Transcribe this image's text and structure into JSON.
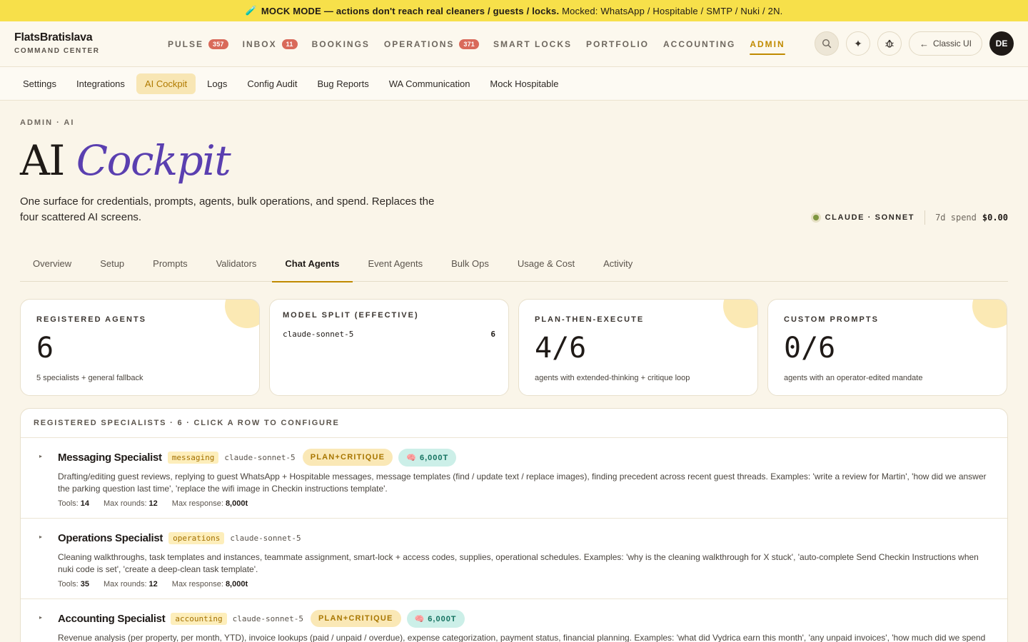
{
  "banner": {
    "icon": "test-tube-icon",
    "strong": "MOCK MODE — actions don't reach real cleaners / guests / locks.",
    "rest": "Mocked: WhatsApp / Hospitable / SMTP / Nuki / 2N."
  },
  "brand": {
    "name": "FlatsBratislava",
    "sub": "COMMAND CENTER"
  },
  "nav": [
    {
      "label": "PULSE",
      "badge": "357"
    },
    {
      "label": "INBOX",
      "badge": "11"
    },
    {
      "label": "BOOKINGS",
      "badge": ""
    },
    {
      "label": "OPERATIONS",
      "badge": "371"
    },
    {
      "label": "SMART LOCKS",
      "badge": ""
    },
    {
      "label": "PORTFOLIO",
      "badge": ""
    },
    {
      "label": "ACCOUNTING",
      "badge": ""
    },
    {
      "label": "ADMIN",
      "badge": "",
      "active": true
    }
  ],
  "header_right": {
    "classic_label": "Classic UI",
    "avatar_initials": "DE"
  },
  "subnav": [
    {
      "label": "Settings"
    },
    {
      "label": "Integrations"
    },
    {
      "label": "AI Cockpit",
      "active": true
    },
    {
      "label": "Logs"
    },
    {
      "label": "Config Audit"
    },
    {
      "label": "Bug Reports"
    },
    {
      "label": "WA Communication"
    },
    {
      "label": "Mock Hospitable"
    }
  ],
  "hero": {
    "crumb": "ADMIN · AI",
    "title_plain": "AI",
    "title_italic": "Cockpit",
    "lede": "One surface for credentials, prompts, agents, bulk operations, and spend. Replaces the four scattered AI screens.",
    "model_name": "CLAUDE · SONNET",
    "spend_label": "7d spend",
    "spend_value": "$0.00"
  },
  "tabs": [
    {
      "label": "Overview"
    },
    {
      "label": "Setup"
    },
    {
      "label": "Prompts"
    },
    {
      "label": "Validators"
    },
    {
      "label": "Chat Agents",
      "active": true
    },
    {
      "label": "Event Agents"
    },
    {
      "label": "Bulk Ops"
    },
    {
      "label": "Usage & Cost"
    },
    {
      "label": "Activity"
    }
  ],
  "cards": {
    "registered": {
      "label": "REGISTERED AGENTS",
      "value": "6",
      "note": "5 specialists + general fallback"
    },
    "split": {
      "label": "MODEL SPLIT (EFFECTIVE)",
      "model": "claude-sonnet-5",
      "count": "6"
    },
    "plan": {
      "label": "PLAN-THEN-EXECUTE",
      "value": "4/6",
      "note": "agents with extended-thinking + critique loop"
    },
    "custom": {
      "label": "CUSTOM PROMPTS",
      "value": "0/6",
      "note": "agents with an operator-edited mandate"
    }
  },
  "specialists": {
    "header": "REGISTERED SPECIALISTS · 6 · CLICK A ROW TO CONFIGURE",
    "rows": [
      {
        "name": "Messaging Specialist",
        "area": "messaging",
        "model": "claude-sonnet-5",
        "plan": "PLAN+CRITIQUE",
        "tokens": "6,000T",
        "desc": "Drafting/editing guest reviews, replying to guest WhatsApp + Hospitable messages, message templates (find / update text / replace images), finding precedent across recent guest threads. Examples: 'write a review for Martin', 'how did we answer the parking question last time', 'replace the wifi image in Checkin instructions template'.",
        "tools_label": "Tools:",
        "tools": "14",
        "rounds_label": "Max rounds:",
        "rounds": "12",
        "resp_label": "Max response:",
        "resp": "8,000t"
      },
      {
        "name": "Operations Specialist",
        "area": "operations",
        "model": "claude-sonnet-5",
        "plan": "",
        "tokens": "",
        "desc": "Cleaning walkthroughs, task templates and instances, teammate assignment, smart-lock + access codes, supplies, operational schedules. Examples: 'why is the cleaning walkthrough for X stuck', 'auto-complete Send Checkin Instructions when nuki code is set', 'create a deep-clean task template'.",
        "tools_label": "Tools:",
        "tools": "35",
        "rounds_label": "Max rounds:",
        "rounds": "12",
        "resp_label": "Max response:",
        "resp": "8,000t"
      },
      {
        "name": "Accounting Specialist",
        "area": "accounting",
        "model": "claude-sonnet-5",
        "plan": "PLAN+CRITIQUE",
        "tokens": "6,000T",
        "desc": "Revenue analysis (per property, per month, YTD), invoice lookups (paid / unpaid / overdue), expense categorization, payment status, financial planning. Examples: 'what did Vydrica earn this month', 'any unpaid invoices', 'how much did we spend on cleaning",
        "tools_label": "",
        "tools": "",
        "rounds_label": "",
        "rounds": "",
        "resp_label": "",
        "resp": ""
      }
    ]
  }
}
